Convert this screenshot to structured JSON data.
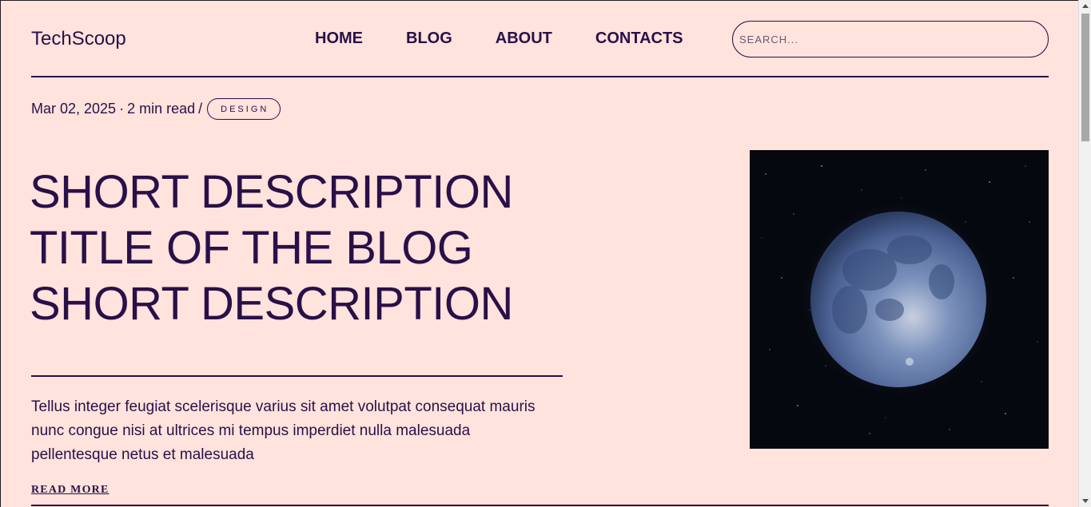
{
  "header": {
    "brand": "TechScoop",
    "nav": [
      "HOME",
      "BLOG",
      "ABOUT",
      "CONTACTS"
    ],
    "search_placeholder": "SEARCH..."
  },
  "post": {
    "date": "Mar 02, 2025",
    "read_time": "2 min read",
    "separator": "/",
    "category": "DESIGN",
    "title_lines": [
      "SHORT DESCRIPTION",
      "TITLE OF THE BLOG",
      "SHORT DESCRIPTION"
    ],
    "excerpt_lines": [
      "Tellus integer feugiat scelerisque varius sit amet volutpat consequat mauris",
      "nunc congue nisi at ultrices mi tempus imperdiet nulla malesuada",
      "pellentesque netus et malesuada"
    ],
    "read_more": "READ MORE",
    "image_subject": "full-moon-in-starry-sky"
  },
  "colors": {
    "background": "#ffe3dc",
    "text": "#2a1048",
    "image_background": "#06080f",
    "moon": "#5f78a6"
  }
}
